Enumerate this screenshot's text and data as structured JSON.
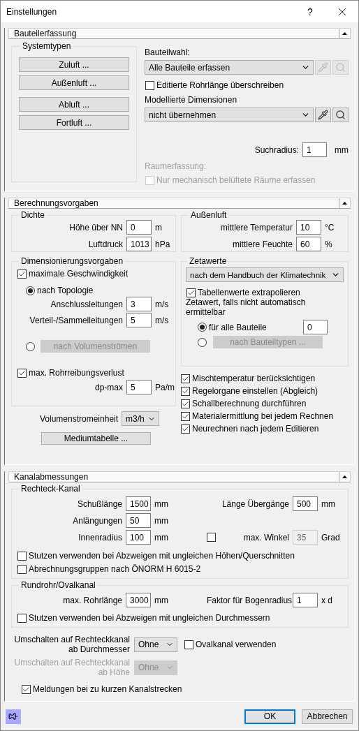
{
  "window": {
    "title": "Einstellungen",
    "help": "?"
  },
  "bauteilerfassung": {
    "title": "Bauteilerfassung",
    "expanded": true,
    "systemtypen": {
      "title": "Systemtypen",
      "button_groups": [
        [
          "Zuluft ...",
          "Außenluft ..."
        ],
        [
          "Abluft ...",
          "Fortluft ..."
        ]
      ]
    },
    "bauteilwahl": {
      "label": "Bauteilwahl:",
      "value": "Alle Bauteile erfassen",
      "tools_disabled": true
    },
    "rohrlaenge": {
      "label": "Editierte Rohrlänge überschreiben",
      "checked": false,
      "disabled": false
    },
    "dimensionen": {
      "label": "Modellierte Dimensionen",
      "value": "nicht übernehmen",
      "tools_disabled": false
    },
    "suchradius": {
      "label": "Suchradius:",
      "value": "1",
      "unit": "mm"
    },
    "raumerfassung": {
      "label": "Raumerfassung:",
      "disabled": true
    },
    "nur_mechanisch": {
      "label": "Nur mechanisch belüftete Räume erfassen",
      "checked": false,
      "disabled": true
    }
  },
  "berechnungsvorgaben": {
    "title": "Berechnungsvorgaben",
    "expanded": true,
    "dichte": {
      "title": "Dichte",
      "fields": [
        {
          "label": "Höhe über NN",
          "value": "0",
          "unit": "m"
        },
        {
          "label": "Luftdruck",
          "value": "1013",
          "unit": "hPa"
        }
      ]
    },
    "aussenluft": {
      "title": "Außenluft",
      "fields": [
        {
          "label": "mittlere Temperatur",
          "value": "10",
          "unit": "°C"
        },
        {
          "label": "mittlere Feuchte",
          "value": "60",
          "unit": "%"
        }
      ]
    },
    "dimensionierung": {
      "title": "Dimensionierungsvorgaben",
      "max_speed": {
        "label": "maximale Geschwindigkeit",
        "checked": true
      },
      "modes": [
        {
          "kind": "fields",
          "label": "nach Topologie",
          "selected": true,
          "fields": [
            {
              "label": "Anschlussleitungen",
              "value": "3",
              "unit": "m/s"
            },
            {
              "label": "Verteil-/Sammelleitungen",
              "value": "5",
              "unit": "m/s"
            }
          ]
        },
        {
          "kind": "button",
          "label": "nach Volumenströmen",
          "selected": false,
          "disabled": true
        }
      ],
      "friction": {
        "label": "max. Rohrreibungsverlust",
        "checked": true,
        "fields": [
          {
            "label": "dp-max",
            "value": "5",
            "unit": "Pa/m"
          }
        ]
      }
    },
    "volumenstromeinheit": {
      "label": "Volumenstromeinheit",
      "value": "m3/h"
    },
    "mediumtabelle": {
      "label": "Mediumtabelle ..."
    },
    "zetawerte": {
      "title": "Zetawerte",
      "method": "nach dem Handbuch der Klimatechnik",
      "extrapolate": {
        "label": "Tabellenwerte extrapolieren",
        "checked": true
      },
      "fallback_label": "Zetawert, falls nicht automatisch ermittelbar",
      "modes": [
        {
          "kind": "input",
          "label": "für alle Bauteile",
          "selected": true,
          "value": "0"
        },
        {
          "kind": "button",
          "label": "nach Bauteiltypen ...",
          "selected": false,
          "disabled": true
        }
      ]
    },
    "options": [
      {
        "label": "Mischtemperatur berücksichtigen",
        "checked": true
      },
      {
        "label": "Regelorgane einstellen (Abgleich)",
        "checked": true
      },
      {
        "label": "Schallberechnung durchführen",
        "checked": true
      },
      {
        "label": "Materialermittlung bei jedem Rechnen",
        "checked": true
      },
      {
        "label": "Neurechnen nach jedem Editieren",
        "checked": true
      }
    ]
  },
  "kanalabmessungen": {
    "title": "Kanalabmessungen",
    "expanded": true,
    "rechteck": {
      "title": "Rechteck-Kanal",
      "rows": [
        {
          "left": {
            "label": "Schußlänge",
            "value": "1500",
            "unit": "mm"
          },
          "right": {
            "label": "Länge Übergänge",
            "value": "500",
            "unit": "mm"
          }
        },
        {
          "left": {
            "label": "Anlängungen",
            "value": "50",
            "unit": "mm"
          }
        },
        {
          "left": {
            "label": "Innenradius",
            "value": "100",
            "unit": "mm"
          },
          "right": {
            "label": "max. Winkel",
            "value": "35",
            "unit": "Grad",
            "toggle": false,
            "disabled": true
          }
        }
      ],
      "options": [
        {
          "label": "Stutzen verwenden bei Abzweigen mit ungleichen Höhen/Querschnitten",
          "checked": false
        },
        {
          "label": "Abrechnungsgruppen nach ÖNORM H 6015-2",
          "checked": false
        }
      ]
    },
    "rundrohr": {
      "title": "Rundrohr/Ovalkanal",
      "rows": [
        {
          "left": {
            "label": "max. Rohrlänge",
            "value": "3000",
            "unit": "mm"
          },
          "right": {
            "label": "Faktor für Bogenradius",
            "value": "1",
            "unit": "x d"
          }
        }
      ],
      "options": [
        {
          "label": "Stutzen verwenden bei Abzweigen mit ungleichen Durchmessern",
          "checked": false
        }
      ]
    },
    "switches": [
      {
        "label": "Umschalten auf Rechteckkanal ab Durchmesser",
        "value": "Ohne",
        "disabled": false,
        "option": {
          "label": "Ovalkanal verwenden",
          "checked": false
        }
      },
      {
        "label": "Umschalten auf Rechteckkanal ab Höhe",
        "value": "Ohne",
        "disabled": true
      }
    ],
    "meldungen": {
      "label": "Meldungen bei zu kurzen Kanalstrecken",
      "checked": true
    }
  },
  "footer": {
    "buttons": [
      {
        "label": "OK",
        "default": true
      },
      {
        "label": "Abbrechen",
        "default": false
      }
    ]
  }
}
